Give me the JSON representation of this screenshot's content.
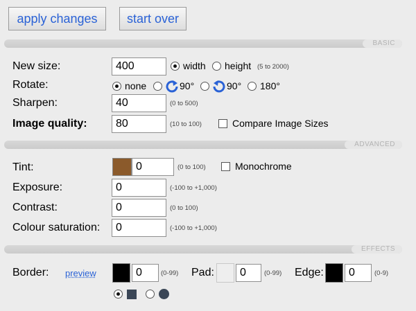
{
  "buttons": {
    "apply": "apply changes",
    "start_over": "start over"
  },
  "sections": {
    "basic": "BASIC",
    "advanced": "ADVANCED",
    "effects": "EFFECTS"
  },
  "basic": {
    "new_size_label": "New size:",
    "new_size_value": "400",
    "size_mode": {
      "width": "width",
      "height": "height",
      "selected": "width"
    },
    "size_hint": "(5 to 2000)",
    "rotate_label": "Rotate:",
    "rotate_options": {
      "none": "none",
      "cw90": "90°",
      "ccw90": "90°",
      "r180": "180°",
      "selected": "none"
    },
    "sharpen_label": "Sharpen:",
    "sharpen_value": "40",
    "sharpen_hint": "(0 to 500)",
    "quality_label": "Image quality:",
    "quality_value": "80",
    "quality_hint": "(10 to 100)",
    "compare_label": "Compare Image Sizes",
    "compare_checked": false
  },
  "advanced": {
    "tint_label": "Tint:",
    "tint_color": "#8b5a2b",
    "tint_value": "0",
    "tint_hint": "(0 to 100)",
    "monochrome_label": "Monochrome",
    "monochrome_checked": false,
    "exposure_label": "Exposure:",
    "exposure_value": "0",
    "exposure_hint": "(-100 to +1,000)",
    "contrast_label": "Contrast:",
    "contrast_value": "0",
    "contrast_hint": "(0 to 100)",
    "saturation_label": "Colour saturation:",
    "saturation_value": "0",
    "saturation_hint": "(-100 to +1,000)"
  },
  "effects": {
    "border_label": "Border:",
    "preview_link": "preview",
    "border_color": "#000000",
    "border_value": "0",
    "border_hint": "(0-99)",
    "pad_label": "Pad:",
    "pad_color": "#eeeeee",
    "pad_value": "0",
    "pad_hint": "(0-99)",
    "edge_label": "Edge:",
    "edge_color": "#000000",
    "edge_value": "0",
    "edge_hint": "(0-9)",
    "shape_selected": "square",
    "shape_icons": [
      "square-icon",
      "circle-icon"
    ],
    "shape_color": "#3a4656"
  }
}
